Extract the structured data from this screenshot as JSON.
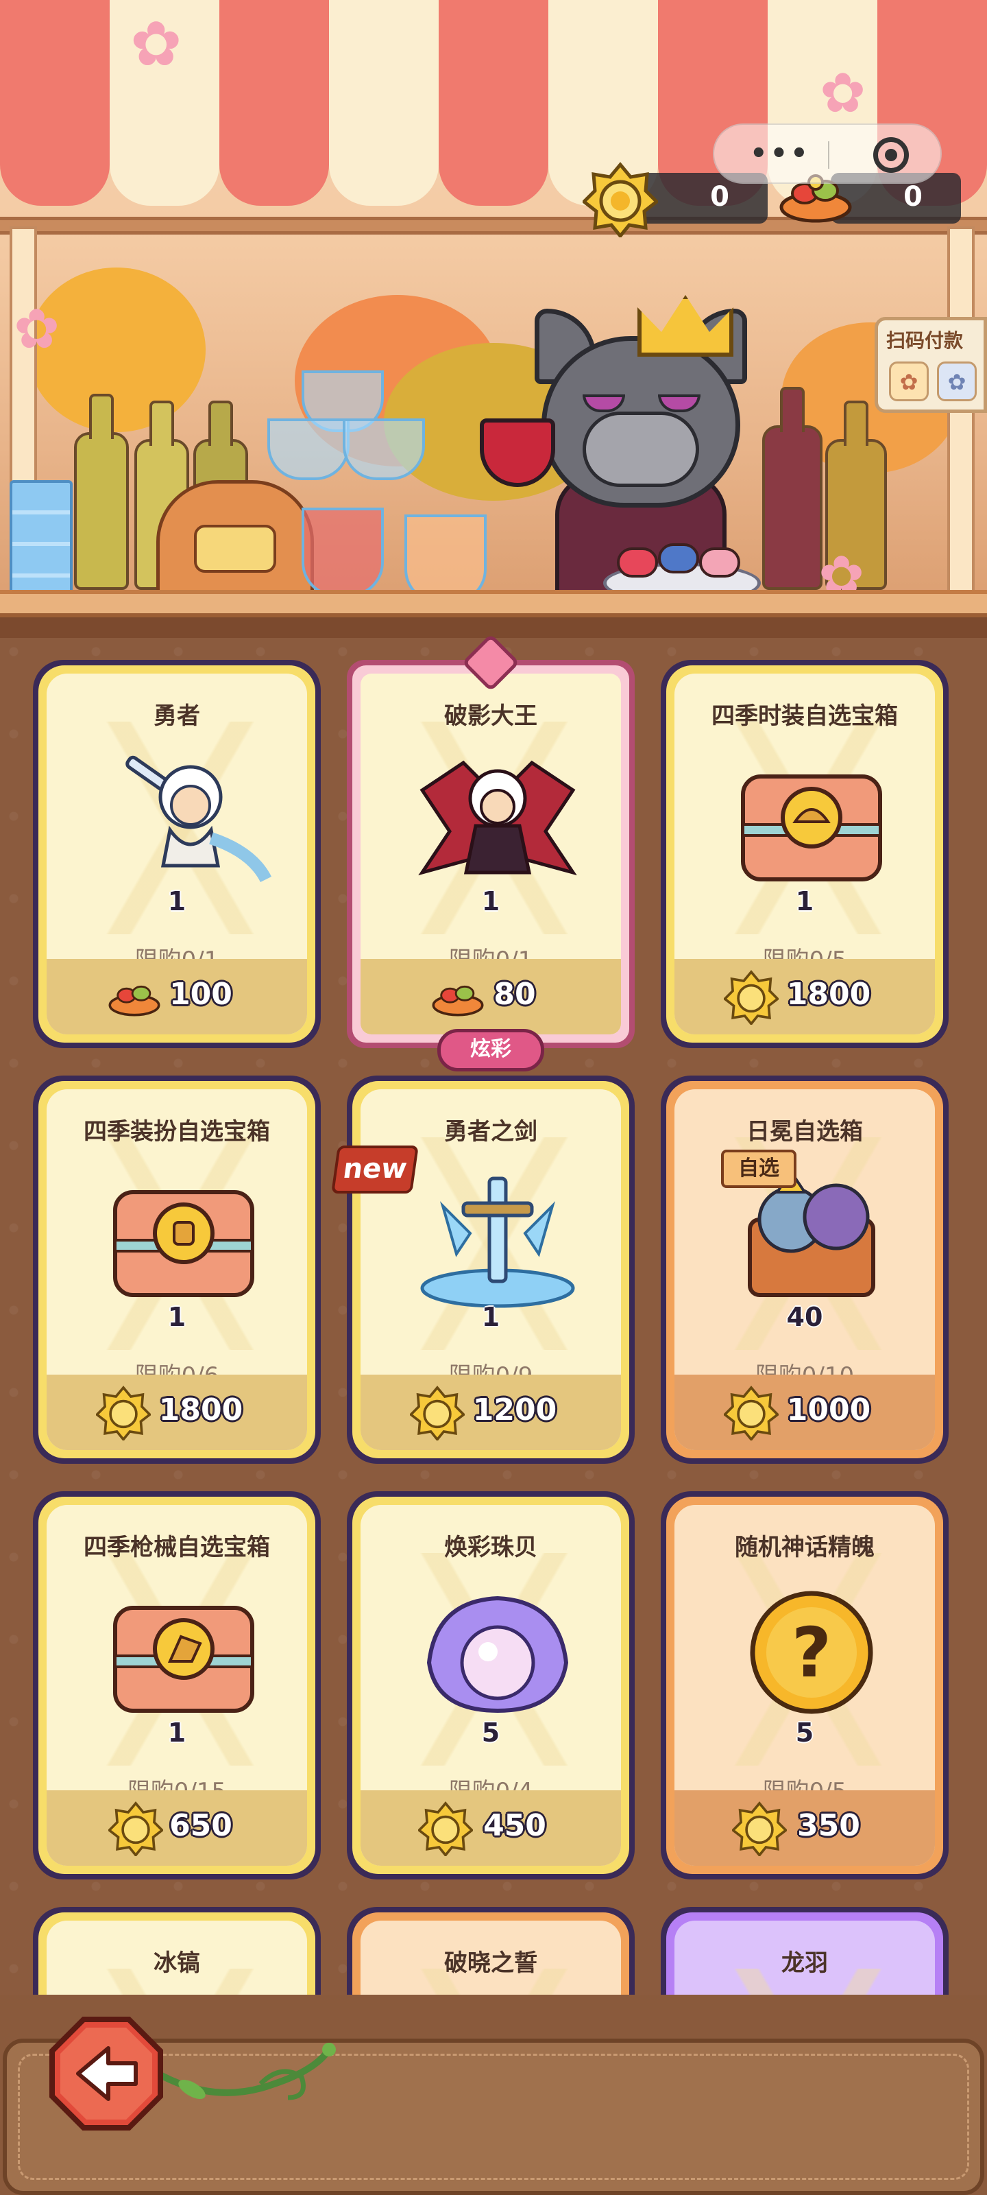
{
  "hud": {
    "coin_count": "0",
    "food_count": "0",
    "menu_dots": "•••",
    "pay_sign_title": "扫码付款"
  },
  "badges": {
    "new": "new",
    "pick": "自选",
    "fancy": "炫彩"
  },
  "shop_items": [
    {
      "title": "勇者",
      "qty": "1",
      "limit": "限购0/1",
      "price": "100",
      "currency": "food-icon",
      "style": "normal"
    },
    {
      "title": "破影大王",
      "qty": "1",
      "limit": "限购0/1",
      "price": "80",
      "currency": "food-icon",
      "style": "fancy"
    },
    {
      "title": "四季时装自选宝箱",
      "qty": "1",
      "limit": "限购0/5",
      "price": "1800",
      "currency": "coin-icon",
      "style": "normal"
    },
    {
      "title": "四季装扮自选宝箱",
      "qty": "1",
      "limit": "限购0/6",
      "price": "1800",
      "currency": "coin-icon",
      "style": "normal"
    },
    {
      "title": "勇者之剑",
      "qty": "1",
      "limit": "限购0/9",
      "price": "1200",
      "currency": "coin-icon",
      "style": "normal"
    },
    {
      "title": "日冕自选箱",
      "qty": "40",
      "limit": "限购0/10",
      "price": "1000",
      "currency": "coin-icon",
      "style": "orange"
    },
    {
      "title": "四季枪械自选宝箱",
      "qty": "1",
      "limit": "限购0/15",
      "price": "650",
      "currency": "coin-icon",
      "style": "normal"
    },
    {
      "title": "焕彩珠贝",
      "qty": "5",
      "limit": "限购0/4",
      "price": "450",
      "currency": "coin-icon",
      "style": "normal"
    },
    {
      "title": "随机神话精魄",
      "qty": "5",
      "limit": "限购0/5",
      "price": "350",
      "currency": "coin-icon",
      "style": "orange"
    },
    {
      "title": "冰镐",
      "style": "normal"
    },
    {
      "title": "破晓之誓",
      "style": "orange"
    },
    {
      "title": "龙羽",
      "style": "purple"
    }
  ],
  "colors": {
    "background": "#8b5b3e",
    "card_gold": "#f7dd6a",
    "card_orange": "#f2a25a",
    "card_purple": "#b680f5",
    "card_fancy": "#b34d71"
  }
}
